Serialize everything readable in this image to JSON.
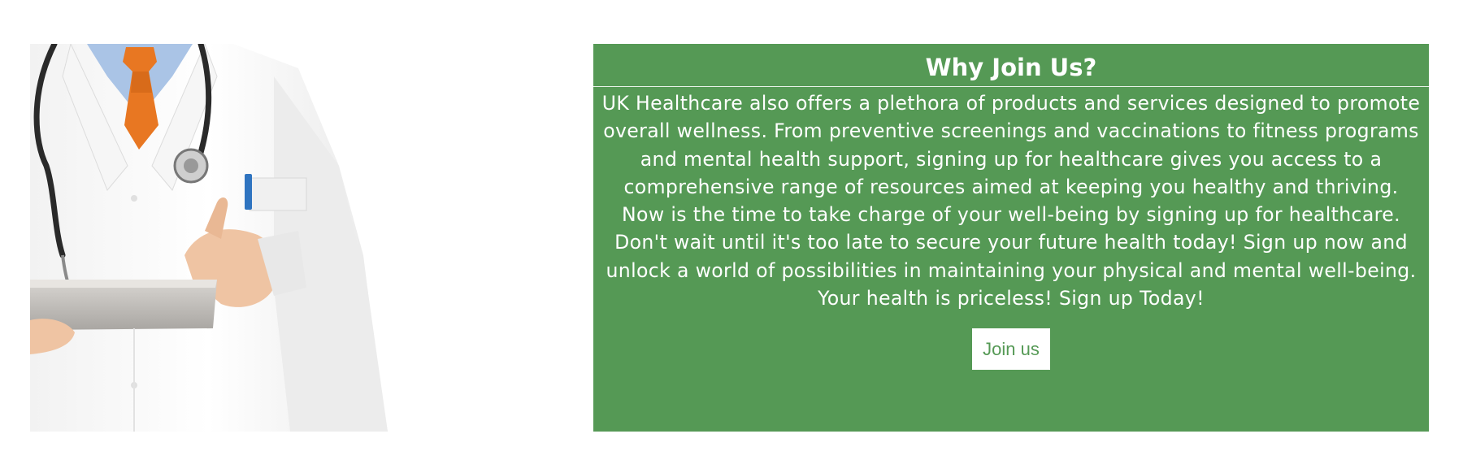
{
  "hero_image": {
    "icon": "doctor-with-tablet-photo"
  },
  "panel": {
    "title": "Why Join Us?",
    "body": "UK Healthcare also offers a plethora of products and services designed to promote overall wellness. From preventive screenings and vaccinations to fitness programs and mental health support, signing up for healthcare gives you access to a comprehensive range of resources aimed at keeping you healthy and thriving. Now is the time to take charge of your well-being by signing up for healthcare. Don't wait until it's too late to secure your future health today! Sign up now and unlock a world of possibilities in maintaining your physical and mental well-being. Your health is priceless! Sign up Today!",
    "button_label": "Join us"
  },
  "colors": {
    "panel_background": "#559955",
    "panel_text": "#ffffff",
    "button_background": "#ffffff",
    "button_text": "#559955",
    "tie": "#e87722"
  }
}
